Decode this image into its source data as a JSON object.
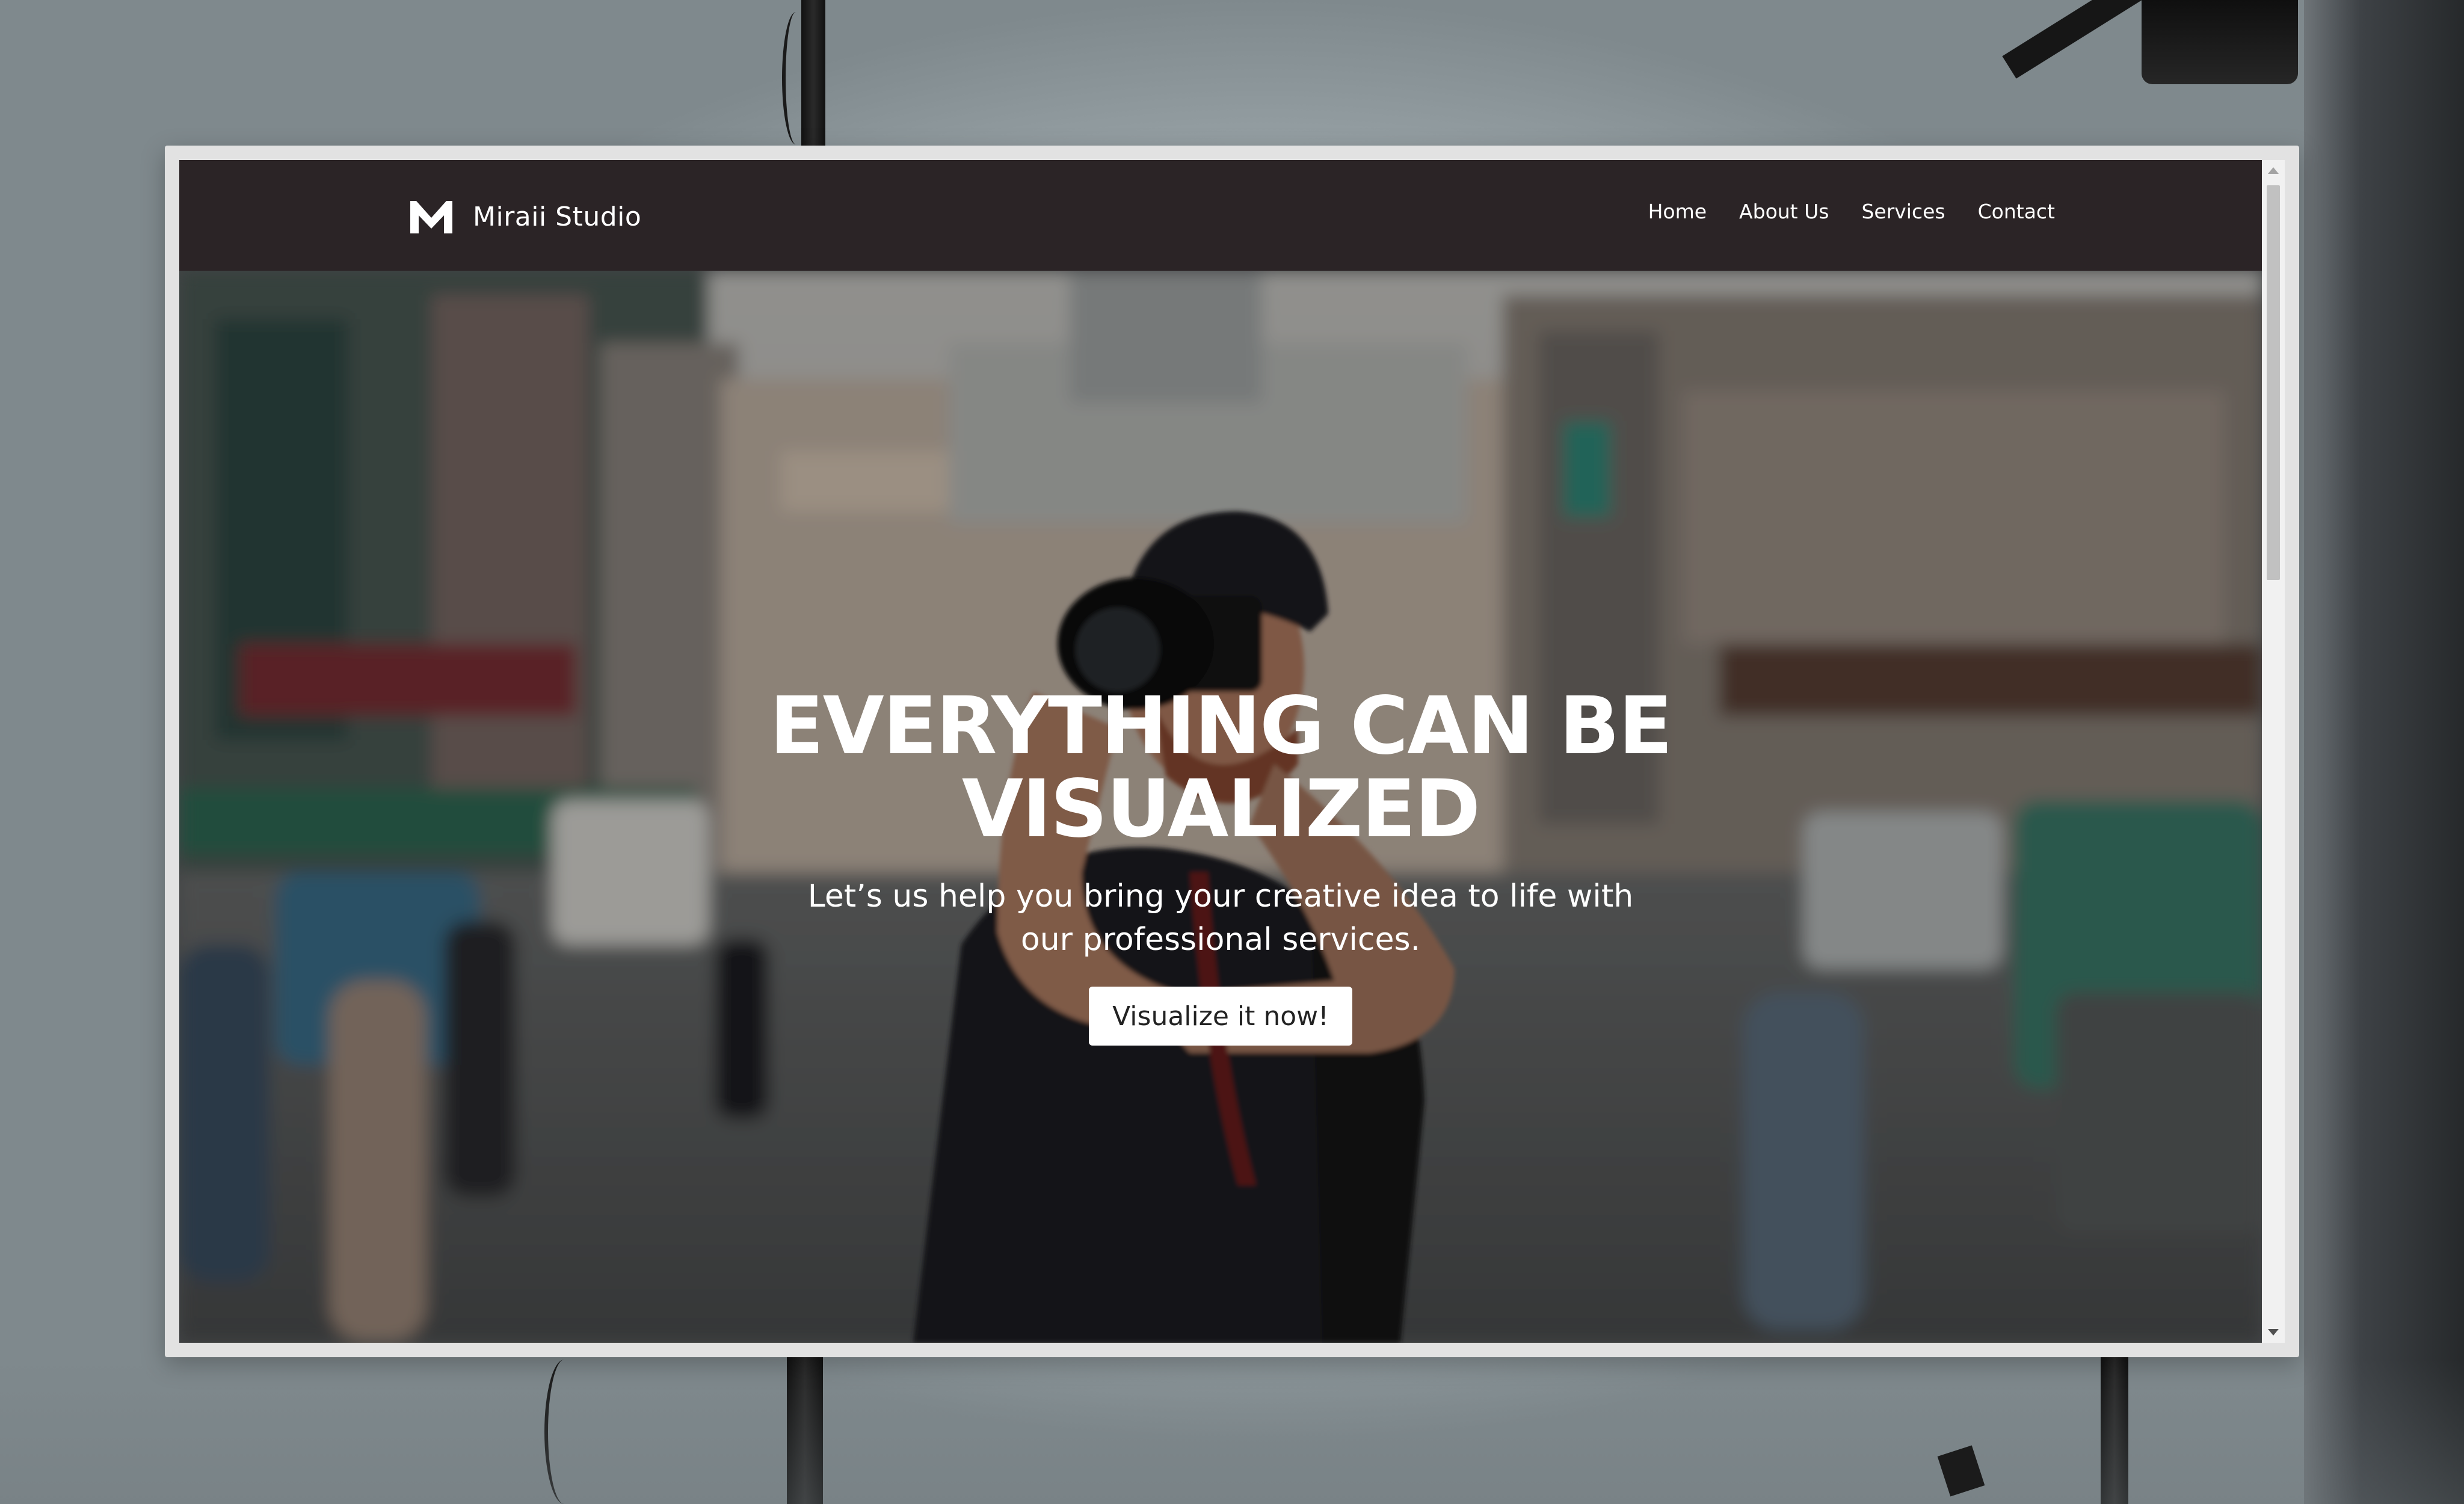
{
  "site": {
    "brand_name": "Miraii Studio",
    "logo_icon": "m-logo-icon"
  },
  "nav": {
    "items": [
      {
        "label": "Home"
      },
      {
        "label": "About Us"
      },
      {
        "label": "Services"
      },
      {
        "label": "Contact"
      }
    ]
  },
  "hero": {
    "title": "EVERYTHING CAN BE VISUALIZED",
    "subtitle": "Let’s us help you bring your creative idea to life with our professional services.",
    "cta_label": "Visualize it now!"
  },
  "colors": {
    "header_bg": "#2b2426",
    "text": "#ffffff",
    "cta_bg": "#ffffff",
    "cta_text": "#222222"
  }
}
